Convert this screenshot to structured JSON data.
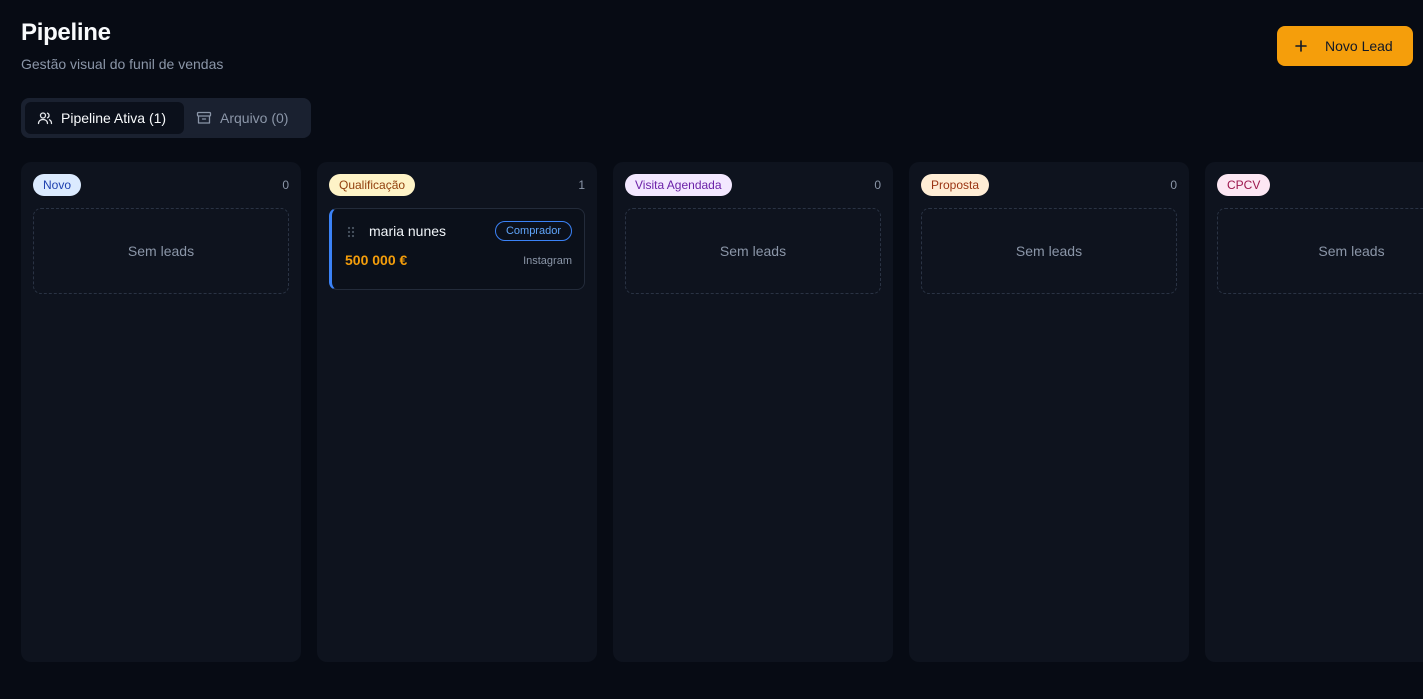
{
  "header": {
    "title": "Pipeline",
    "subtitle": "Gestão visual do funil de vendas",
    "new_lead_label": "Novo Lead"
  },
  "tabs": [
    {
      "label": "Pipeline Ativa (1)",
      "icon": "users-icon",
      "active": true
    },
    {
      "label": "Arquivo (0)",
      "icon": "archive-icon",
      "active": false
    }
  ],
  "columns": [
    {
      "label": "Novo",
      "count": "0",
      "badge_bg": "#dbeafe",
      "badge_fg": "#1e40af",
      "empty_text": "Sem leads"
    },
    {
      "label": "Qualificação",
      "count": "1",
      "badge_bg": "#fef3c7",
      "badge_fg": "#92400e",
      "card": {
        "name": "maria nunes",
        "role": "Comprador",
        "value": "500 000 €",
        "source": "Instagram"
      }
    },
    {
      "label": "Visita Agendada",
      "count": "0",
      "badge_bg": "#f3e8ff",
      "badge_fg": "#6b21a8",
      "empty_text": "Sem leads"
    },
    {
      "label": "Proposta",
      "count": "0",
      "badge_bg": "#ffedd5",
      "badge_fg": "#9a3412",
      "empty_text": "Sem leads"
    },
    {
      "label": "CPCV",
      "count": "",
      "badge_bg": "#fce7f3",
      "badge_fg": "#9d174d",
      "empty_text": "Sem leads"
    }
  ],
  "colors": {
    "accent": "#f59e0b",
    "card_border": "#3b82f6",
    "background": "#070b14"
  }
}
